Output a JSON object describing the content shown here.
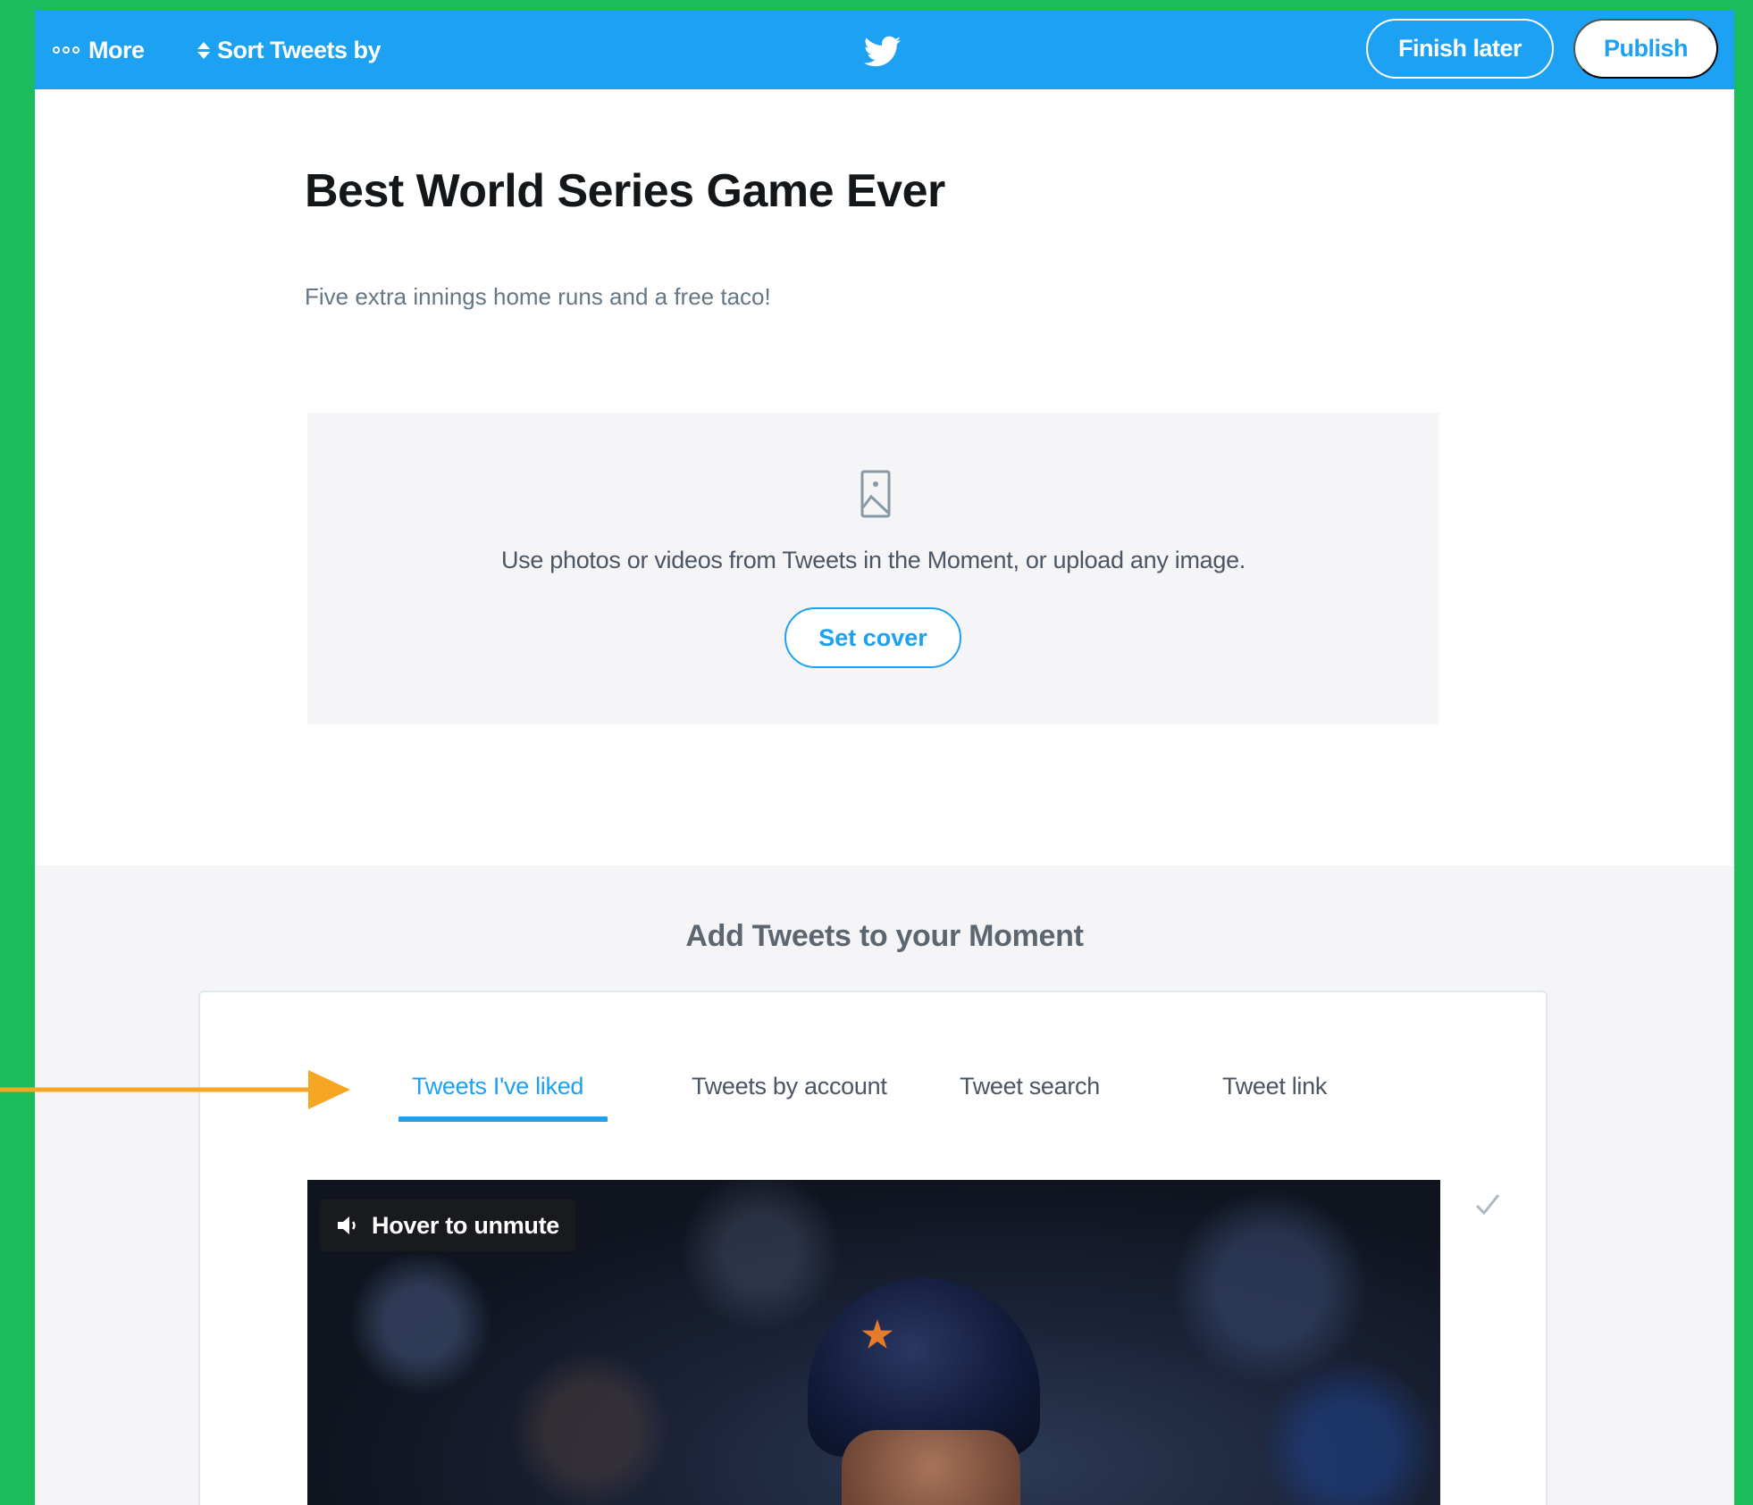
{
  "topbar": {
    "more_label": "More",
    "sort_label": "Sort Tweets by",
    "finish_label": "Finish later",
    "publish_label": "Publish"
  },
  "moment": {
    "title": "Best World Series Game Ever",
    "description": "Five extra innings home runs and a free taco!"
  },
  "cover": {
    "hint": "Use photos or videos from Tweets in the Moment, or upload any image.",
    "button_label": "Set cover"
  },
  "add_tweets": {
    "heading": "Add Tweets to your Moment",
    "tabs": [
      {
        "label": "Tweets I've liked",
        "active": true
      },
      {
        "label": "Tweets by account",
        "active": false
      },
      {
        "label": "Tweet search",
        "active": false
      },
      {
        "label": "Tweet link",
        "active": false
      }
    ],
    "media": {
      "unmute_label": "Hover to unmute"
    }
  },
  "colors": {
    "brand_blue": "#1da1f2",
    "background_green": "#1bbc5b",
    "annotation_arrow": "#f5a623"
  },
  "icons": [
    "dots-icon",
    "sort-icon",
    "twitter-bird-icon",
    "image-icon",
    "speaker-icon",
    "checkmark-icon",
    "arrow-annotation"
  ]
}
